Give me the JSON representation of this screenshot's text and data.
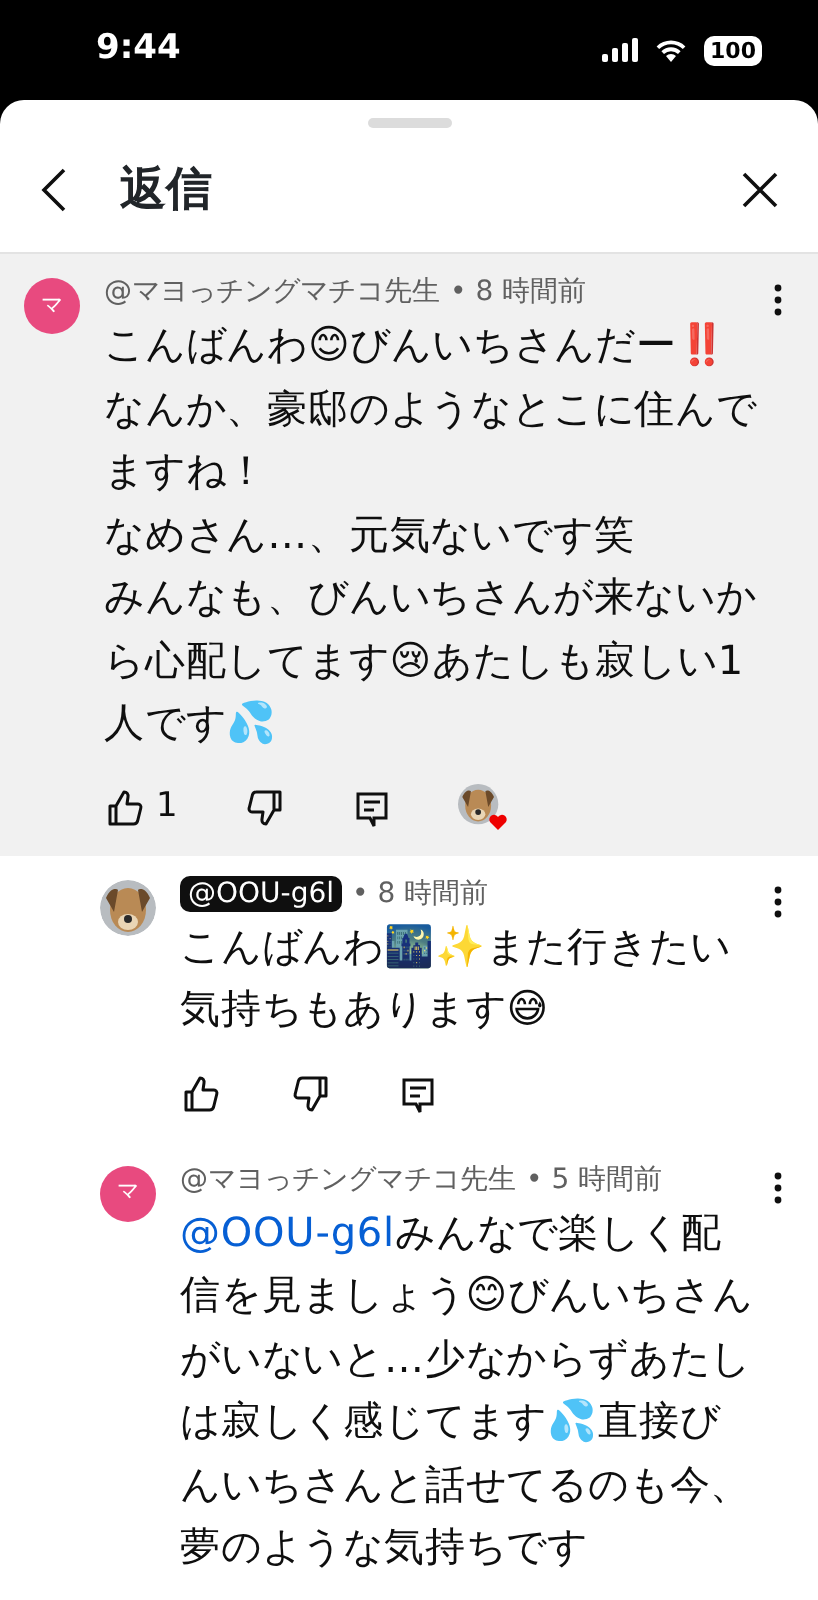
{
  "status_bar": {
    "time": "9:44",
    "battery": "100"
  },
  "header": {
    "title": "返信"
  },
  "comments": [
    {
      "kind": "parent",
      "author": "@マヨっチングマチコ先生",
      "avatar_letter": "マ",
      "owner": false,
      "time": "• 8 時間前",
      "paragraphs": [
        "こんばんわ😊びんいちさんだー‼️なんか、豪邸のようなとこに住んでますね！",
        "なめさん…、元気ないです笑",
        "みんなも、びんいちさんが来ないから心配してます😢あたしも寂しい1人です💦"
      ],
      "likes": "1",
      "actions": true,
      "hearted": true,
      "highlighted": true
    },
    {
      "kind": "reply",
      "author": "@OOU-g6l",
      "owner": true,
      "time": "• 8 時間前",
      "paragraphs": [
        "こんばんわ🌃✨また行きたい気持ちもあります😅"
      ],
      "actions": true,
      "hearted": false,
      "highlighted": false
    },
    {
      "kind": "reply",
      "author": "@マヨっチングマチコ先生",
      "avatar_letter": "マ",
      "owner": false,
      "time": "• 5 時間前",
      "mention": "@OOU-g6l",
      "paragraphs": [
        "みんなで楽しく配信を見ましょう😊びんいちさんがいないと…少なからずあたしは寂しく感じてます💦直接びんいちさんと話せてるのも今、夢のような気持ちです"
      ],
      "hearted": false,
      "highlighted": false
    }
  ]
}
